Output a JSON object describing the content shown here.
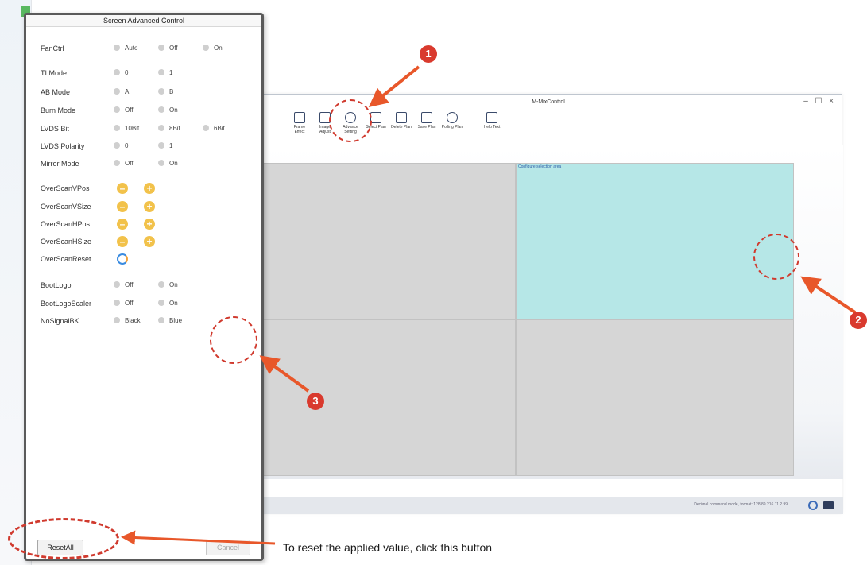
{
  "dialog": {
    "title": "Screen Advanced Control",
    "fanctrl": {
      "label": "FanCtrl",
      "options": [
        "Auto",
        "Off",
        "On"
      ]
    },
    "ti_mode": {
      "label": "TI Mode",
      "options": [
        "0",
        "1"
      ]
    },
    "ab_mode": {
      "label": "AB Mode",
      "options": [
        "A",
        "B"
      ]
    },
    "burn_mode": {
      "label": "Burn Mode",
      "options": [
        "Off",
        "On"
      ]
    },
    "lvds_bit": {
      "label": "LVDS Bit",
      "options": [
        "10Bit",
        "8Bit",
        "6Bit"
      ]
    },
    "lvds_polarity": {
      "label": "LVDS Polarity",
      "options": [
        "0",
        "1"
      ]
    },
    "mirror_mode": {
      "label": "Mirror Mode",
      "options": [
        "Off",
        "On"
      ]
    },
    "overscan_vpos": {
      "label": "OverScanVPos"
    },
    "overscan_vsize": {
      "label": "OverScanVSize"
    },
    "overscan_hpos": {
      "label": "OverScanHPos"
    },
    "overscan_hsize": {
      "label": "OverScanHSize"
    },
    "overscan_reset": {
      "label": "OverScanReset"
    },
    "bootlogo": {
      "label": "BootLogo",
      "options": [
        "Off",
        "On"
      ]
    },
    "bootlogo_scaler": {
      "label": "BootLogoScaler",
      "options": [
        "Off",
        "On"
      ]
    },
    "nosignal_bk": {
      "label": "NoSignalBK",
      "options": [
        "Black",
        "Blue"
      ]
    },
    "resetall_label": "ResetAll",
    "cancel_label": "Cancel"
  },
  "main_window": {
    "title": "M-MixControl",
    "controls": {
      "minimize": "–",
      "maximize": "☐",
      "close": "×"
    },
    "toolbar": [
      {
        "label": "Frame Effect",
        "icon": "frame-icon"
      },
      {
        "label": "Image Adjust",
        "icon": "image-icon"
      },
      {
        "label": "Advance Setting",
        "icon": "gear-icon"
      },
      {
        "label": "Select Plan",
        "icon": "select-icon"
      },
      {
        "label": "Delete Plan",
        "icon": "delete-icon"
      },
      {
        "label": "Save Plan",
        "icon": "save-icon"
      },
      {
        "label": "Polling Plan",
        "icon": "polling-icon"
      },
      {
        "label": "Help Text",
        "icon": "help-icon"
      }
    ],
    "selected_cell_label": "Configure selection area",
    "status_text": "Decimal command mode, format: 128 89 216 11 2 99"
  },
  "annotations": {
    "badge_1": "1",
    "badge_2": "2",
    "badge_3": "3",
    "instruction": "To reset the applied value, click this button",
    "arrow_color": "#e8572a",
    "ring_color": "#d03a2e"
  }
}
